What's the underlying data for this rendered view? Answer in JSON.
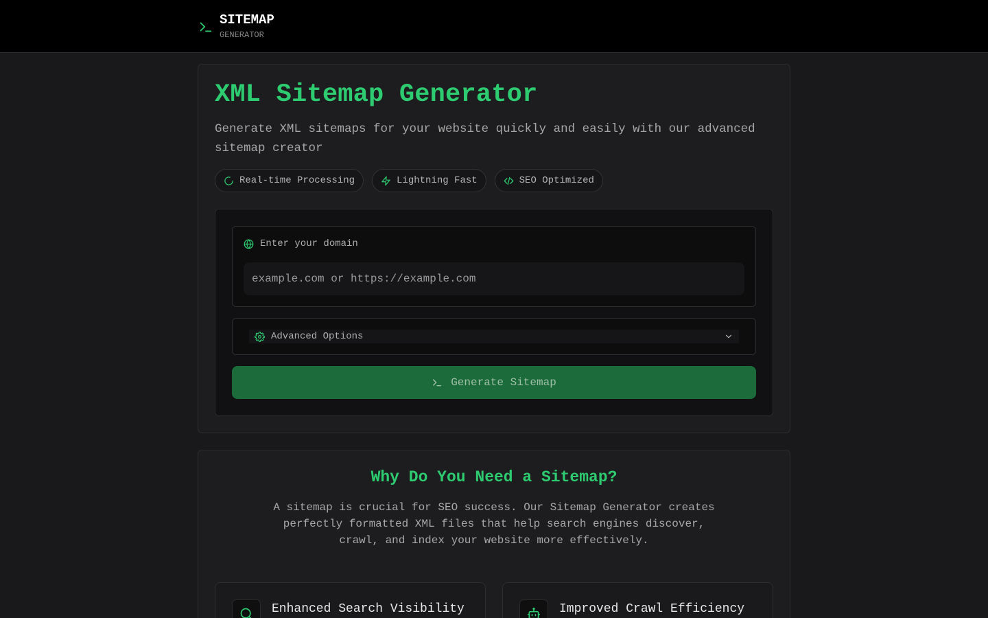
{
  "header": {
    "brand_title": "SITEMAP",
    "brand_sub": "GENERATOR",
    "brand_icon": "terminal-icon"
  },
  "hero": {
    "title": "XML Sitemap Generator",
    "description": "Generate XML sitemaps for your website quickly and easily with our advanced sitemap creator",
    "chips": [
      {
        "label": "Real-time Processing",
        "icon": "spinner-icon"
      },
      {
        "label": "Lightning Fast",
        "icon": "lightning-icon"
      },
      {
        "label": "SEO Optimized",
        "icon": "code-icon"
      }
    ]
  },
  "form": {
    "domain_label": "Enter your domain",
    "domain_placeholder": "example.com or https://example.com",
    "domain_value": "",
    "advanced_label": "Advanced Options",
    "generate_label": "Generate Sitemap"
  },
  "why": {
    "title": "Why Do You Need a Sitemap?",
    "description": "A sitemap is crucial for SEO success. Our Sitemap Generator creates perfectly formatted XML files that help search engines discover, crawl, and index your website more effectively.",
    "features": [
      {
        "title": "Enhanced Search Visibility",
        "icon": "search-icon"
      },
      {
        "title": "Improved Crawl Efficiency",
        "icon": "robot-icon"
      }
    ]
  },
  "colors": {
    "accent": "#2ecc71",
    "button": "#1c6b3a",
    "background": "#19191b",
    "header": "#000000"
  }
}
